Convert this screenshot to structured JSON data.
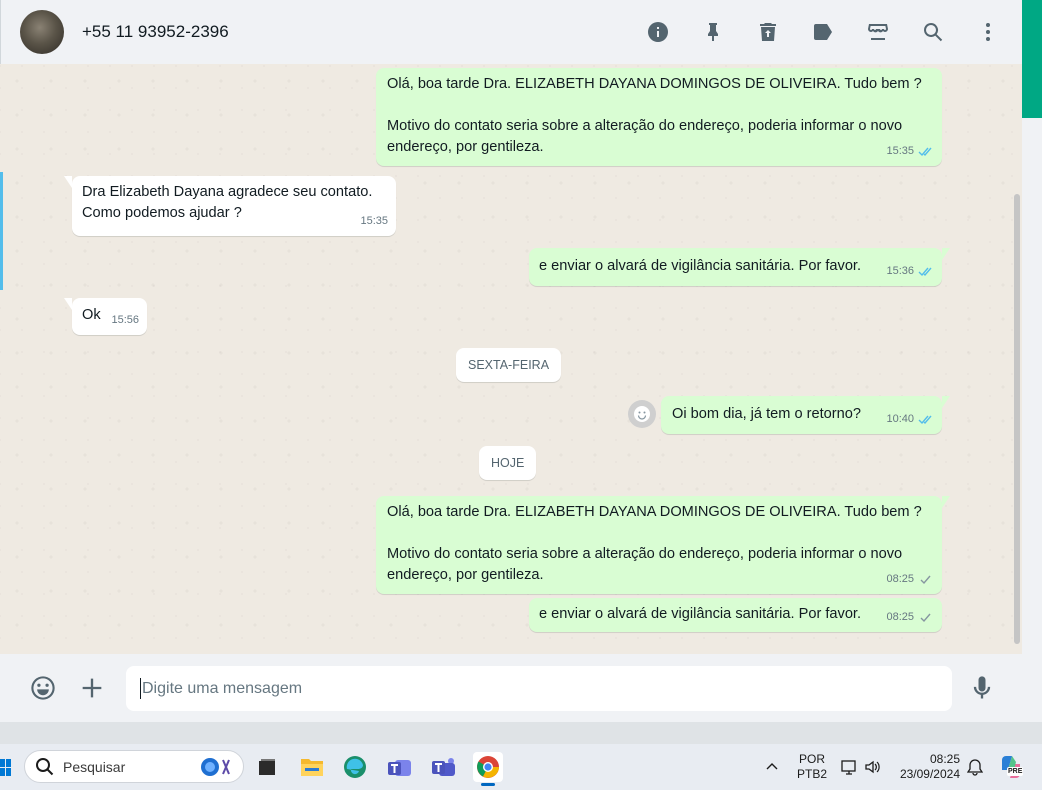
{
  "header": {
    "contact_name": "+55 11 93952-2396",
    "actions": [
      "info-icon",
      "pin-icon",
      "trash-icon",
      "label-icon",
      "store-icon",
      "search-icon",
      "more-vertical-icon"
    ]
  },
  "messages": [
    {
      "id": "m1",
      "direction": "out",
      "text": "Olá, boa tarde Dra. ELIZABETH DAYANA DOMINGOS DE OLIVEIRA. Tudo bem ?\n\nMotivo do contato seria sobre a alteração do endereço, poderia informar o novo endereço, por gentileza.",
      "time": "15:35",
      "status": "read"
    },
    {
      "id": "m2",
      "direction": "in",
      "text": "Dra Elizabeth Dayana agradece seu contato.\nComo podemos ajudar ?",
      "time": "15:35"
    },
    {
      "id": "m3",
      "direction": "out",
      "text": "e enviar o alvará de vigilância sanitária. Por favor.",
      "time": "15:36",
      "status": "read"
    },
    {
      "id": "m4",
      "direction": "in",
      "text": "Ok",
      "time": "15:56"
    },
    {
      "id": "m5",
      "direction": "out",
      "text": "Oi bom dia, já tem o retorno?",
      "time": "10:40",
      "status": "read"
    },
    {
      "id": "m6",
      "direction": "out",
      "text": "Olá, boa tarde Dra. ELIZABETH DAYANA DOMINGOS DE OLIVEIRA. Tudo bem ?\n\nMotivo do contato seria sobre a alteração do endereço, poderia informar o novo endereço, por gentileza.",
      "time": "08:25",
      "status": "sent"
    },
    {
      "id": "m7",
      "direction": "out",
      "text": "e enviar o alvará de vigilância sanitária. Por favor.",
      "time": "08:25",
      "status": "sent"
    }
  ],
  "date_separators": {
    "friday": "SEXTA-FEIRA",
    "today": "HOJE"
  },
  "composer": {
    "placeholder": "Digite uma mensagem",
    "value": ""
  },
  "taskbar": {
    "search_label": "Pesquisar",
    "language": "POR",
    "keyboard": "PTB2",
    "time": "08:25",
    "date": "23/09/2024",
    "copilot_badge": "PRE"
  },
  "colors": {
    "accent": "#00a884",
    "outgoing_bubble": "#d9fdd3",
    "incoming_bubble": "#ffffff",
    "read_tick": "#53bdeb",
    "chat_background": "#efeae2"
  }
}
